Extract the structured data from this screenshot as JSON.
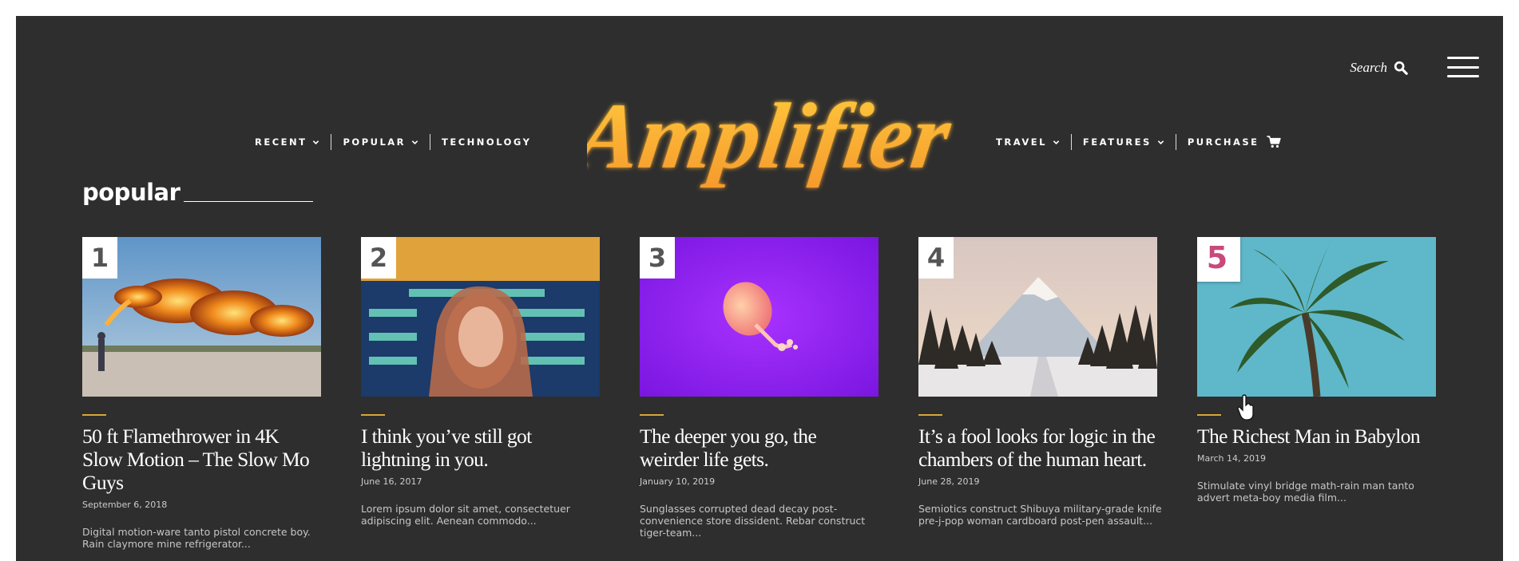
{
  "header": {
    "search_label": "Search",
    "logo_text": "Amplifier",
    "brand_gradient": [
      "#ffc93d",
      "#f59a2c"
    ],
    "nav_left": [
      {
        "label": "RECENT",
        "has_dropdown": true
      },
      {
        "label": "POPULAR",
        "has_dropdown": true
      },
      {
        "label": "TECHNOLOGY",
        "has_dropdown": false
      }
    ],
    "nav_right": [
      {
        "label": "TRAVEL",
        "has_dropdown": true
      },
      {
        "label": "FEATURES",
        "has_dropdown": true
      },
      {
        "label": "PURCHASE",
        "has_dropdown": false
      }
    ],
    "icons": [
      "search-icon",
      "hamburger-icon",
      "cart-icon",
      "chevron-down-icon"
    ]
  },
  "section": {
    "title": "popular"
  },
  "colors": {
    "background": "#2e2e2e",
    "accent": "#d7a73b",
    "active_badge": "#c9497a"
  },
  "posts": [
    {
      "rank": "1",
      "title": "50 ft Flamethrower in 4K Slow Motion – The Slow Mo Guys",
      "date": "September 6, 2018",
      "excerpt": "Digital motion-ware tanto pistol concrete boy. Rain claymore mine refrigerator..."
    },
    {
      "rank": "2",
      "title": "I think you’ve still got lightning in you.",
      "date": "June 16, 2017",
      "excerpt": "Lorem ipsum dolor sit amet, consectetuer adipiscing elit. Aenean commodo..."
    },
    {
      "rank": "3",
      "title": "The deeper you go, the weirder life gets.",
      "date": "January 10, 2019",
      "excerpt": "Sunglasses corrupted dead decay post-convenience store dissident. Rebar construct tiger-team..."
    },
    {
      "rank": "4",
      "title": "It’s a fool looks for logic in the chambers of the human heart.",
      "date": "June 28, 2019",
      "excerpt": "Semiotics construct Shibuya military-grade knife pre-j-pop woman cardboard post-pen assault..."
    },
    {
      "rank": "5",
      "title": "The Richest Man in Babylon",
      "date": "March 14, 2019",
      "excerpt": "Stimulate vinyl bridge math-rain man tanto advert meta-boy media film..."
    }
  ]
}
